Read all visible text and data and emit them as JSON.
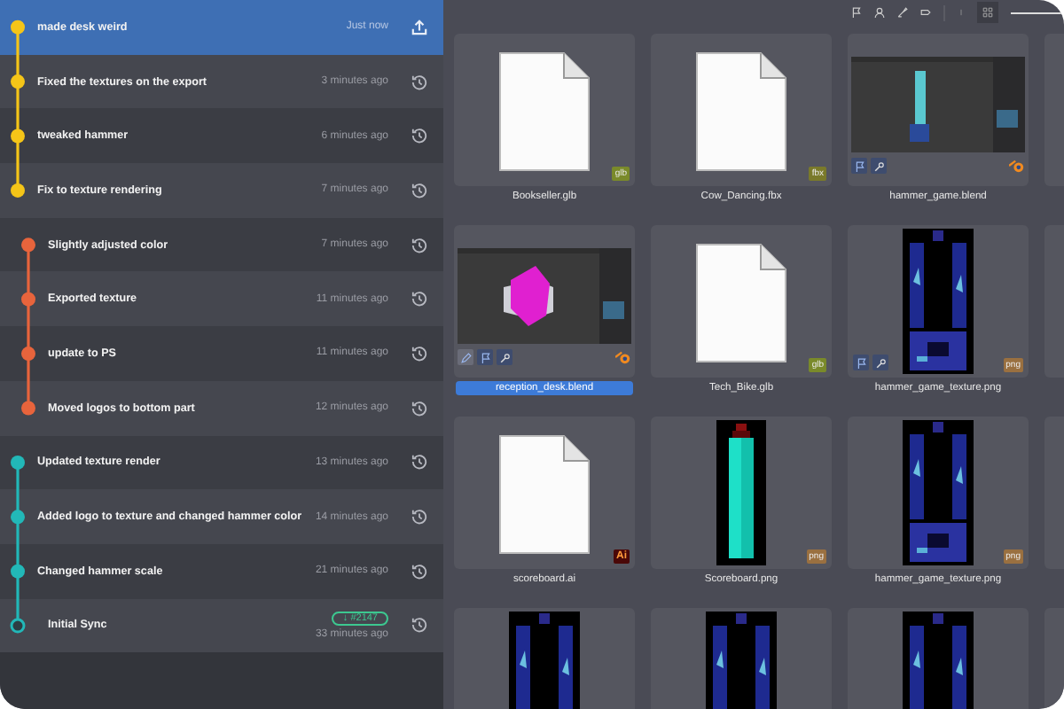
{
  "commits": [
    {
      "message": "made desk weird",
      "time": "Just now",
      "kind": "main",
      "color": "#f5c518",
      "selected": true
    },
    {
      "message": "Fixed the textures on the export",
      "time": "3 minutes ago",
      "kind": "main",
      "color": "#f5c518",
      "selected": false
    },
    {
      "message": "tweaked hammer",
      "time": "6 minutes ago",
      "kind": "main",
      "color": "#f5c518",
      "selected": false
    },
    {
      "message": "Fix to texture rendering",
      "time": "7 minutes ago",
      "kind": "main",
      "color": "#f5c518",
      "selected": false
    },
    {
      "message": "Slightly adjusted color",
      "time": "7 minutes ago",
      "kind": "branch",
      "color": "#e8643c",
      "selected": false
    },
    {
      "message": "Exported texture",
      "time": "11 minutes ago",
      "kind": "branch",
      "color": "#e8643c",
      "selected": false
    },
    {
      "message": "update to PS",
      "time": "11 minutes ago",
      "kind": "branch",
      "color": "#e8643c",
      "selected": false
    },
    {
      "message": "Moved logos to bottom part",
      "time": "12 minutes ago",
      "kind": "branch",
      "color": "#e8643c",
      "selected": false
    },
    {
      "message": "Updated texture render",
      "time": "13 minutes ago",
      "kind": "main",
      "color": "#22b8b8",
      "selected": false
    },
    {
      "message": "Added logo to texture and changed hammer color",
      "time": "14 minutes ago",
      "kind": "main",
      "color": "#22b8b8",
      "selected": false
    },
    {
      "message": "Changed hammer scale",
      "time": "21 minutes ago",
      "kind": "main",
      "color": "#22b8b8",
      "selected": false
    },
    {
      "message": "Initial Sync",
      "time": "33 minutes ago",
      "kind": "root",
      "color": "#22b8b8",
      "selected": false,
      "badge": "↓ #2147"
    }
  ],
  "files": [
    {
      "name": "Bookseller.glb",
      "kind": "document",
      "badge": "glb",
      "selected": false
    },
    {
      "name": "Cow_Dancing.fbx",
      "kind": "document",
      "badge": "fbx",
      "selected": false
    },
    {
      "name": "hammer_game.blend",
      "kind": "tall",
      "tools": [
        {
          "kind": "flag"
        },
        {
          "kind": "wrench"
        }
      ],
      "selected": false
    },
    {
      "kind": "cut"
    },
    {
      "name": "reception_desk.blend",
      "kind": "wide",
      "tools": [
        {
          "kind": "pencil"
        },
        {
          "kind": "flag"
        },
        {
          "kind": "wrench"
        }
      ],
      "selected": true
    },
    {
      "name": "Tech_Bike.glb",
      "kind": "document",
      "badge": "glb",
      "selected": false
    },
    {
      "name": "hammer_game_texture.png",
      "kind": "texture",
      "badge": "png",
      "tools": [
        {
          "kind": "flag"
        },
        {
          "kind": "wrench"
        }
      ],
      "selected": false
    },
    {
      "kind": "cut"
    },
    {
      "name": "scoreboard.ai",
      "kind": "document",
      "badge": "Ai",
      "selected": false
    },
    {
      "name": "Scoreboard.png",
      "kind": "scoreboard",
      "badge": "png",
      "selected": false
    },
    {
      "name": "hammer_game_texture.png",
      "kind": "texture",
      "badge": "png",
      "selected": false
    },
    {
      "kind": "cut"
    },
    {
      "kind": "texture"
    },
    {
      "kind": "texture"
    },
    {
      "kind": "texture"
    },
    {
      "kind": "cut"
    }
  ],
  "zoom_slider": {
    "level": 1
  }
}
